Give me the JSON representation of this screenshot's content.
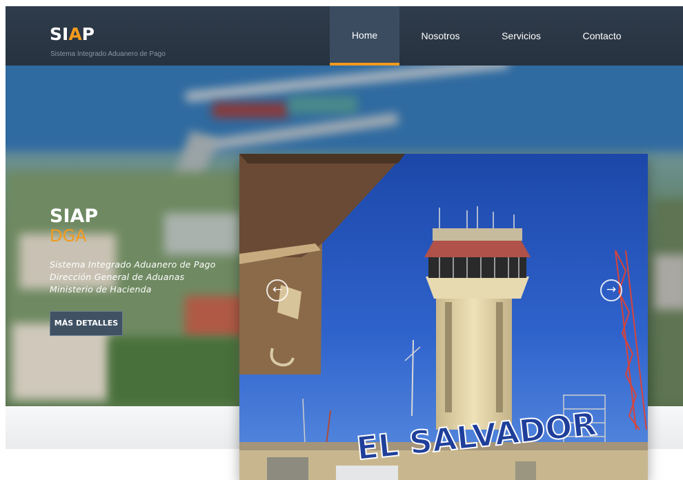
{
  "header": {
    "brand_main": "SI",
    "brand_accent": "A",
    "brand_end": "P",
    "tagline": "Sistema Integrado Aduanero de Pago"
  },
  "nav": {
    "items": [
      {
        "label": "Home",
        "active": true
      },
      {
        "label": "Nosotros",
        "active": false
      },
      {
        "label": "Servicios",
        "active": false
      },
      {
        "label": "Contacto",
        "active": false
      }
    ]
  },
  "hero": {
    "title": "SIAP",
    "subtitle": "DGA",
    "description": "Sistema Integrado Aduanero de Pago Dirección General de Aduanas Ministerio de Hacienda",
    "button_label": "MÁS DETALLES"
  },
  "slider": {
    "prev_icon": "arrow-left-icon",
    "next_icon": "arrow-right-icon",
    "prev_glyph": "←",
    "next_glyph": "→",
    "sign_text": "EL SALVADOR"
  },
  "colors": {
    "accent": "#f29a1d",
    "nav_bg": "#2f3c4b",
    "nav_active_bg": "#3b4c60",
    "sky": "#1f4fb8"
  }
}
